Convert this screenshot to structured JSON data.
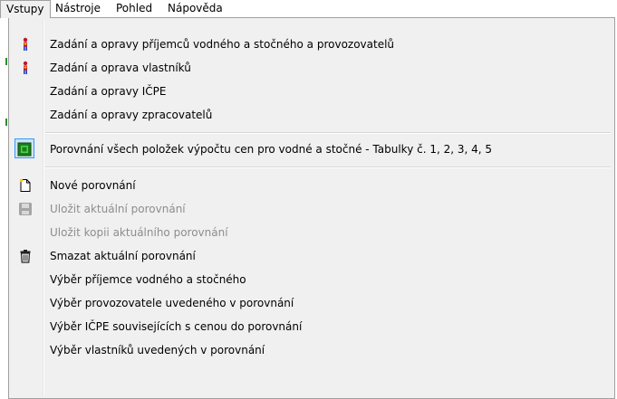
{
  "menubar": {
    "items": [
      {
        "label": "Vstupy",
        "open": true
      },
      {
        "label": "Nástroje"
      },
      {
        "label": "Pohled"
      },
      {
        "label": "Nápověda"
      }
    ]
  },
  "menu": {
    "items": [
      {
        "label": "Zadání a opravy příjemců vodného a stočného a provozovatelů",
        "icon": "person-icon",
        "enabled": true
      },
      {
        "label": "Zadání a oprava vlastníků",
        "icon": "person-icon",
        "enabled": true
      },
      {
        "label": "Zadání a opravy IČPE",
        "icon": "",
        "enabled": true
      },
      {
        "label": "Zadání a opravy zpracovatelů",
        "icon": "",
        "enabled": true
      },
      {
        "label": "Porovnání všech položek výpočtu cen pro vodné a stočné - Tabulky č. 1, 2, 3, 4, 5",
        "icon": "table-green-icon",
        "enabled": true
      },
      {
        "label": "Nové porovnání",
        "icon": "new-document-icon",
        "enabled": true
      },
      {
        "label": "Uložit aktuální porovnání",
        "icon": "save-icon",
        "enabled": false
      },
      {
        "label": "Uložit kopii aktuálního porovnání",
        "icon": "",
        "enabled": false
      },
      {
        "label": "Smazat aktuální porovnání",
        "icon": "trash-icon",
        "enabled": true
      },
      {
        "label": "Výběr příjemce vodného a stočného",
        "icon": "",
        "enabled": true
      },
      {
        "label": "Výběr provozovatele uvedeného v porovnání",
        "icon": "",
        "enabled": true
      },
      {
        "label": "Výběr IČPE souvisejících s cenou do porovnání",
        "icon": "",
        "enabled": true
      },
      {
        "label": "Výběr vlastníků uvedených v porovnání",
        "icon": "",
        "enabled": true
      }
    ]
  }
}
